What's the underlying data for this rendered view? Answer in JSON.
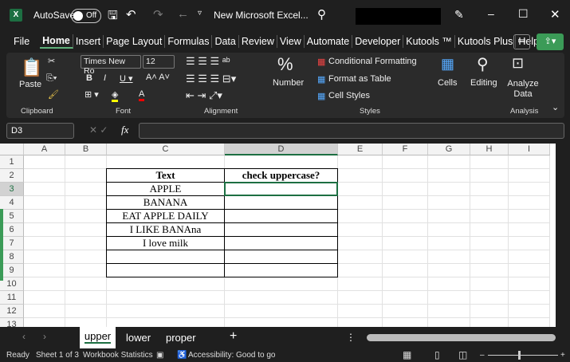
{
  "titlebar": {
    "app_icon": "X",
    "autosave": "AutoSave",
    "toggle": "Off",
    "filename": "New Microsoft Excel...",
    "search_icon": "search-icon"
  },
  "tabs": [
    "File",
    "Home",
    "Insert",
    "Page Layout",
    "Formulas",
    "Data",
    "Review",
    "View",
    "Automate",
    "Developer",
    "Kutools ™",
    "Kutools Plus",
    "Help"
  ],
  "ribbon": {
    "paste": "Paste",
    "font_name": "Times New Ro",
    "font_size": "12",
    "number": "Number",
    "cond_fmt": "Conditional Formatting",
    "fmt_table": "Format as Table",
    "cell_styles": "Cell Styles",
    "cells": "Cells",
    "editing": "Editing",
    "analyze": "Analyze Data",
    "groups": {
      "clipboard": "Clipboard",
      "font": "Font",
      "alignment": "Alignment",
      "styles": "Styles",
      "analysis": "Analysis"
    }
  },
  "formula_bar": {
    "name_box": "D3",
    "fx": "fx",
    "value": ""
  },
  "columns": [
    "A",
    "B",
    "C",
    "D",
    "E",
    "F",
    "G",
    "H",
    "I"
  ],
  "rows": [
    "1",
    "2",
    "3",
    "4",
    "5",
    "6",
    "7",
    "8",
    "9",
    "10",
    "11",
    "12",
    "13"
  ],
  "table": {
    "header": [
      "Text",
      "check uppercase?"
    ],
    "rows": [
      [
        "APPLE",
        ""
      ],
      [
        "BANANA",
        ""
      ],
      [
        "EAT APPLE DAILY",
        ""
      ],
      [
        "I LIKE BANAna",
        ""
      ],
      [
        "I love milk",
        ""
      ],
      [
        "",
        ""
      ],
      [
        "",
        ""
      ]
    ]
  },
  "sheets": [
    "upper",
    "lower",
    "proper"
  ],
  "status": {
    "ready": "Ready",
    "sheet": "Sheet 1 of 3",
    "stats": "Workbook Statistics",
    "accessibility": "Accessibility: Good to go"
  }
}
